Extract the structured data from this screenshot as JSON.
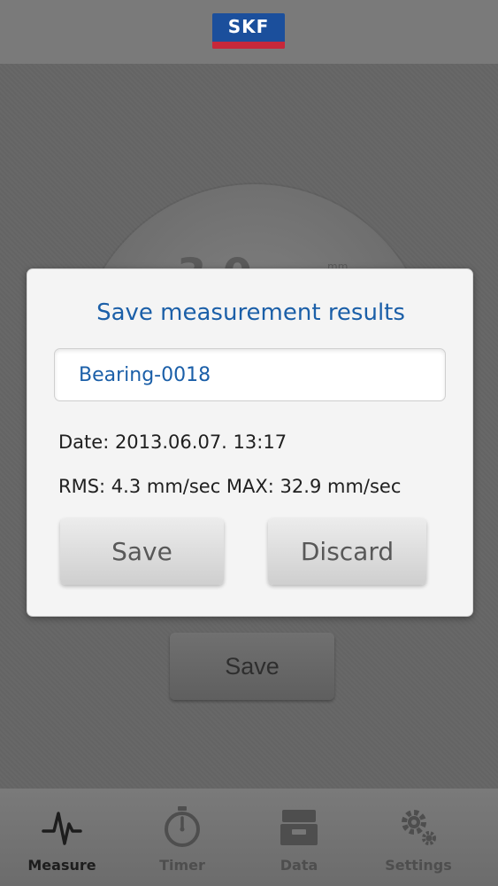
{
  "header": {
    "logo_text": "SKF"
  },
  "background": {
    "gauge_value": "3.0",
    "gauge_unit": "mm",
    "save_label": "Save"
  },
  "dialog": {
    "title": "Save measurement results",
    "name_value": "Bearing-0018",
    "date_line": "Date: 2013.06.07. 13:17",
    "rms_line": "RMS: 4.3 mm/sec MAX: 32.9 mm/sec",
    "save_label": "Save",
    "discard_label": "Discard"
  },
  "nav": {
    "items": [
      {
        "label": "Measure",
        "icon": "measure-icon",
        "active": true
      },
      {
        "label": "Timer",
        "icon": "timer-icon",
        "active": false
      },
      {
        "label": "Data",
        "icon": "data-icon",
        "active": false
      },
      {
        "label": "Settings",
        "icon": "settings-icon",
        "active": false
      }
    ]
  },
  "colors": {
    "accent": "#1b5fa8",
    "skf_blue": "#1b4f9c",
    "skf_red": "#c7283a"
  }
}
